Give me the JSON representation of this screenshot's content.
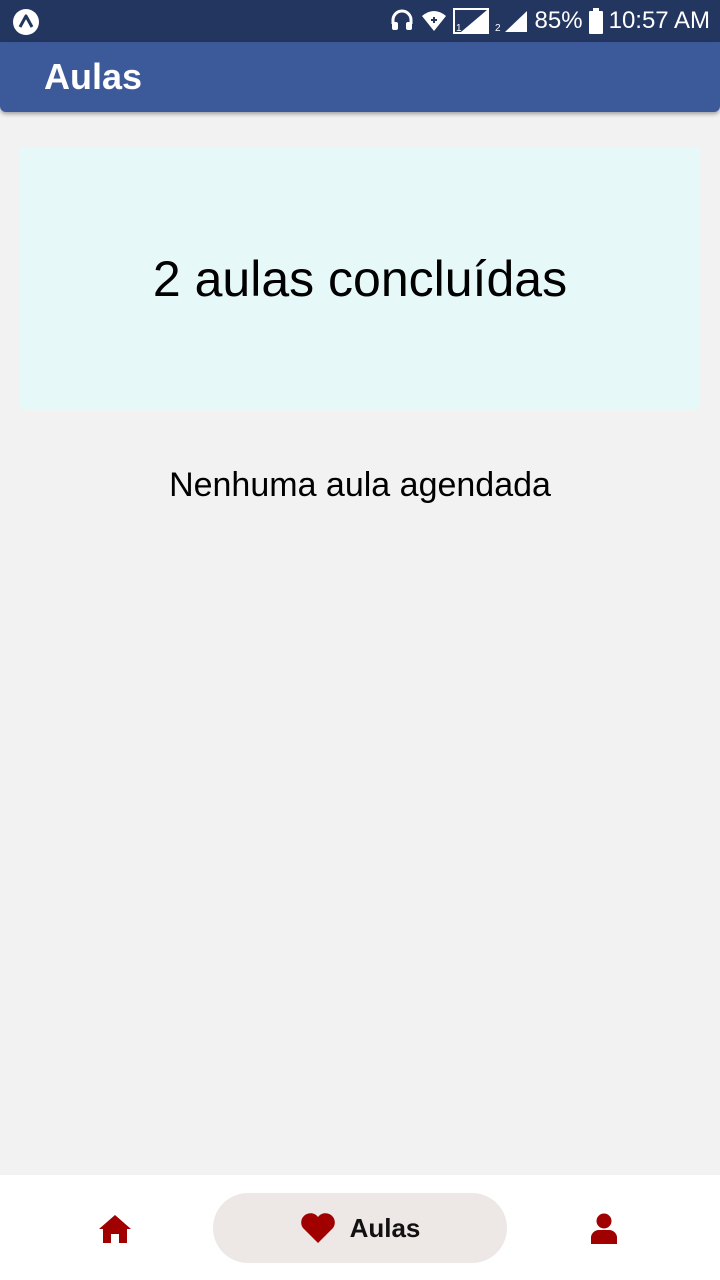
{
  "status_bar": {
    "battery": "85%",
    "time": "10:57 AM",
    "sim1": "1",
    "sim2": "2",
    "icons": [
      "app-launcher-icon",
      "headset-icon",
      "wifi-icon",
      "signal-icon",
      "battery-icon"
    ]
  },
  "app_bar": {
    "title": "Aulas",
    "color": "#3c5a9a"
  },
  "summary": {
    "text": "2 aulas concluídas",
    "background": "#e6f8f8"
  },
  "schedule": {
    "empty_text": "Nenhuma aula agendada"
  },
  "bottom_nav": {
    "items": [
      {
        "icon": "home-icon",
        "label": "",
        "active": false
      },
      {
        "icon": "heart-icon",
        "label": "Aulas",
        "active": true
      },
      {
        "icon": "user-icon",
        "label": "",
        "active": false
      }
    ],
    "icon_color": "#a00000",
    "active_pill_color": "#ede7e5"
  }
}
